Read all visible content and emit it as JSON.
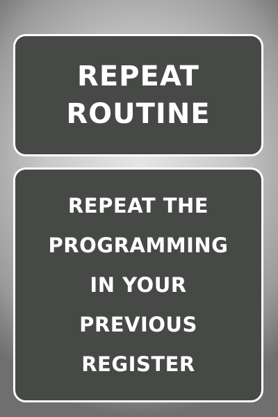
{
  "title_panel": {
    "lines": [
      "REPEAT",
      "ROUTINE"
    ]
  },
  "description_panel": {
    "lines": [
      "REPEAT THE",
      "PROGRAMMING",
      "IN YOUR",
      "PREVIOUS",
      "REGISTER"
    ]
  },
  "colors": {
    "panel_fill": "#464946",
    "panel_border": "#ffffff",
    "text": "#ffffff"
  }
}
